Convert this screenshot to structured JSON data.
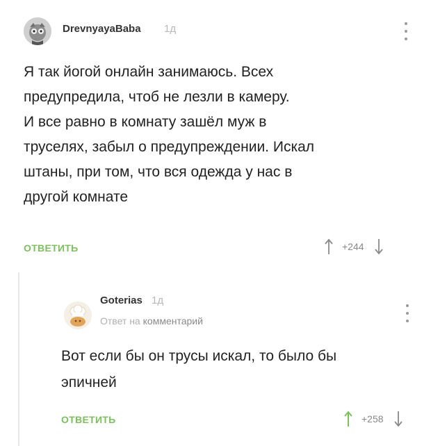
{
  "comment": {
    "username": "DrevnyayaBaba",
    "age": "1д",
    "text": "Я так йогой онлайн занимаюсь. Всех\nпредупредила, чтоб не лезли в камеру.\nИ все равно в комнату зашёл муж в\nтруселях, забыл о предупреждении. Искал\nштаны, при том, что вся одежда у нас в\nдругой комнате",
    "reply_label": "ОТВЕТИТЬ",
    "score": "+244"
  },
  "reply": {
    "username": "Goterias",
    "age": "1д",
    "reply_to_prefix": "Ответ на",
    "reply_to_link": "комментарий",
    "text": "Вот если бы он трусы искал, то было бы\nэпичней",
    "reply_label": "ОТВЕТИТЬ",
    "score": "+258",
    "upvote_color": "#7cbf5e"
  },
  "icons": {
    "menu": "more-vertical-icon",
    "up": "arrow-up-icon",
    "down": "arrow-down-icon"
  },
  "colors": {
    "accent": "#7cbf5e",
    "muted": "#b8b8b8"
  }
}
